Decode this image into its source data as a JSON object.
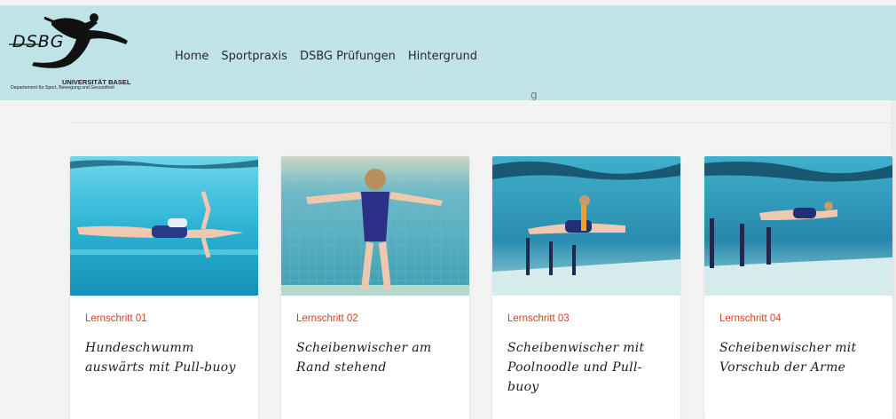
{
  "logo": {
    "wordmark": "DSBG",
    "university": "UNIVERSITÄT BASEL",
    "department": "Departement für Sport, Bewegung und Gesundheit"
  },
  "nav": {
    "items": [
      {
        "label": "Home"
      },
      {
        "label": "Sportpraxis"
      },
      {
        "label": "DSBG Prüfungen"
      },
      {
        "label": "Hintergrund"
      }
    ]
  },
  "page": {
    "peek_text": "g"
  },
  "colors": {
    "header_bg": "#bfe3e6",
    "accent": "#d2421d",
    "pool_water": "#2ab3d4"
  },
  "cards": [
    {
      "step": "Lernschritt 01",
      "title": "Hundeschwumm auswärts mit Pull-buoy",
      "image": "underwater-swimmer-with-pullbuoy"
    },
    {
      "step": "Lernschritt 02",
      "title": "Scheibenwischer am Rand stehend",
      "image": "standing-swimmer-at-pool-wall"
    },
    {
      "step": "Lernschritt 03",
      "title": "Scheibenwischer mit Poolnoodle und Pull-buoy",
      "image": "swimmer-with-poolnoodle"
    },
    {
      "step": "Lernschritt 04",
      "title": "Scheibenwischer mit Vorschub der Arme",
      "image": "swimmer-arms-forward"
    }
  ]
}
